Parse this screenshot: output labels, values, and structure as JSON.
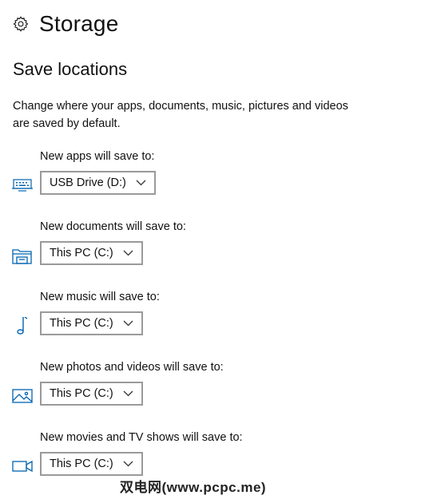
{
  "header": {
    "title": "Storage",
    "icon": "gear-icon"
  },
  "section": {
    "title": "Save locations",
    "description": "Change where your apps, documents, music, pictures and videos are saved by default."
  },
  "locations": [
    {
      "label": "New apps will save to:",
      "value": "USB Drive (D:)",
      "icon": "apps-icon"
    },
    {
      "label": "New documents will save to:",
      "value": "This PC (C:)",
      "icon": "documents-folder-icon"
    },
    {
      "label": "New music will save to:",
      "value": "This PC (C:)",
      "icon": "music-note-icon"
    },
    {
      "label": "New photos and videos will save to:",
      "value": "This PC (C:)",
      "icon": "photo-icon"
    },
    {
      "label": "New movies and TV shows will save to:",
      "value": "This PC (C:)",
      "icon": "video-camera-icon"
    }
  ],
  "watermark": "双电网(www.pcpc.me)",
  "colors": {
    "accent": "#0063b1",
    "border": "#9a9a9a"
  }
}
